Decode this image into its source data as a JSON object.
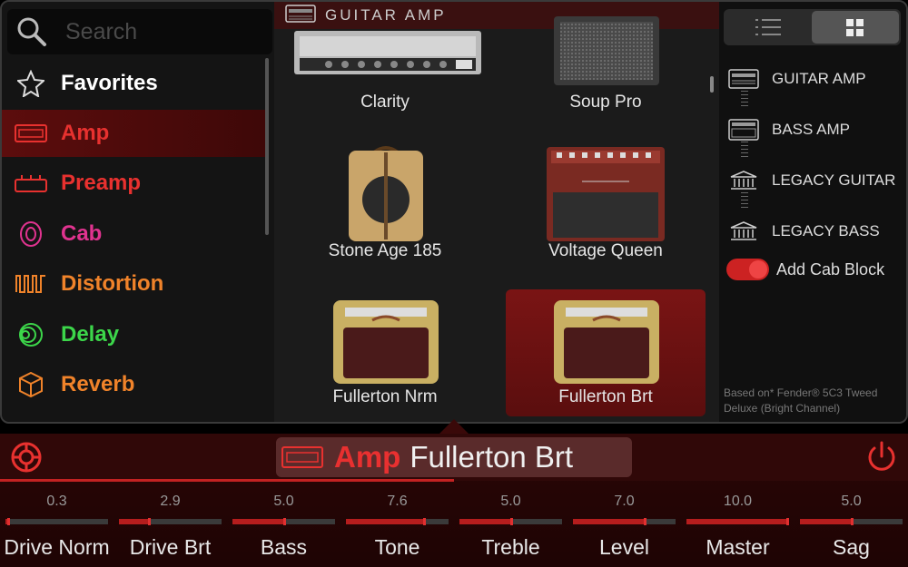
{
  "search": {
    "placeholder": "Search"
  },
  "categories": [
    {
      "label": "Favorites",
      "icon": "star-icon",
      "color": "#ffffff"
    },
    {
      "label": "Amp",
      "icon": "amp-icon",
      "color": "#e8312f"
    },
    {
      "label": "Preamp",
      "icon": "preamp-icon",
      "color": "#e8312f"
    },
    {
      "label": "Cab",
      "icon": "cab-icon",
      "color": "#e0338f"
    },
    {
      "label": "Distortion",
      "icon": "distortion-icon",
      "color": "#f0832a"
    },
    {
      "label": "Delay",
      "icon": "delay-icon",
      "color": "#3cd64a"
    },
    {
      "label": "Reverb",
      "icon": "reverb-icon",
      "color": "#f0832a"
    }
  ],
  "center": {
    "header": "GUITAR AMP",
    "models": [
      {
        "name": "Clarity"
      },
      {
        "name": "Soup Pro"
      },
      {
        "name": "Stone Age 185"
      },
      {
        "name": "Voltage Queen"
      },
      {
        "name": "Fullerton Nrm"
      },
      {
        "name": "Fullerton Brt",
        "selected": true
      }
    ]
  },
  "right": {
    "types": [
      {
        "label": "GUITAR AMP",
        "icon": "guitar-amp-icon"
      },
      {
        "label": "BASS AMP",
        "icon": "bass-amp-icon"
      },
      {
        "label": "LEGACY GUITAR",
        "icon": "legacy-icon"
      },
      {
        "label": "LEGACY BASS",
        "icon": "legacy-icon"
      }
    ],
    "add_cab_label": "Add Cab Block",
    "add_cab_on": true,
    "based_on": "Based on* Fender® 5C3 Tweed Deluxe (Bright Channel)"
  },
  "bottom": {
    "category": "Amp",
    "model": "Fullerton Brt",
    "params": [
      {
        "label": "Drive Norm",
        "value": "0.3",
        "level": 0.03
      },
      {
        "label": "Drive Brt",
        "value": "2.9",
        "level": 0.29
      },
      {
        "label": "Bass",
        "value": "5.0",
        "level": 0.5
      },
      {
        "label": "Tone",
        "value": "7.6",
        "level": 0.76
      },
      {
        "label": "Treble",
        "value": "5.0",
        "level": 0.5
      },
      {
        "label": "Level",
        "value": "7.0",
        "level": 0.7
      },
      {
        "label": "Master",
        "value": "10.0",
        "level": 1.0
      },
      {
        "label": "Sag",
        "value": "5.0",
        "level": 0.5
      }
    ]
  },
  "colors": {
    "accent": "#e8312f"
  }
}
